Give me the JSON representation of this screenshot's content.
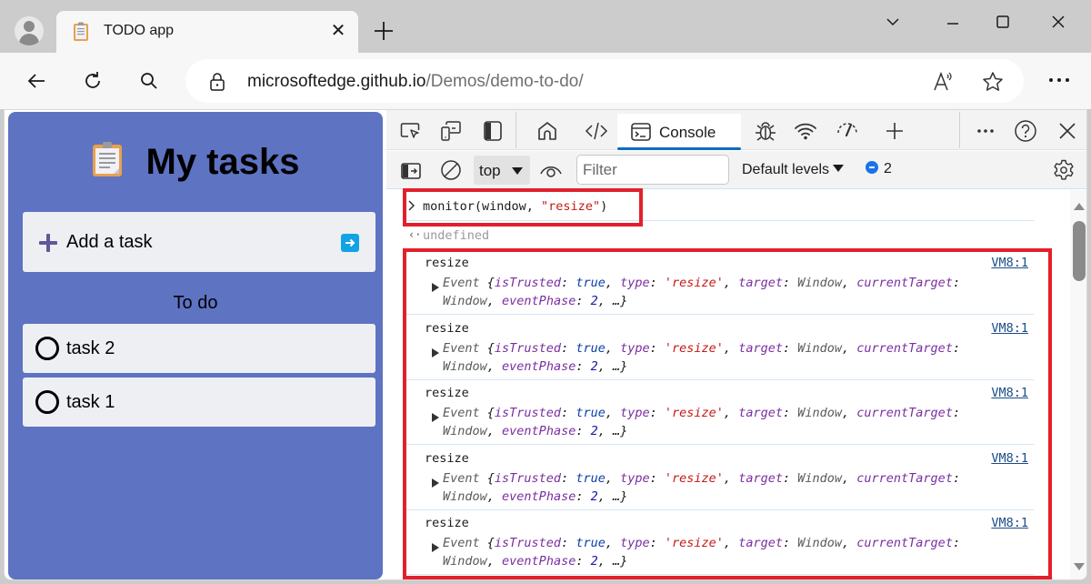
{
  "browser": {
    "tab": {
      "title": "TODO app",
      "favicon": "clipboard-icon"
    },
    "address_bar": {
      "host": "microsoftedge.github.io",
      "path": "/Demos/demo-to-do/"
    },
    "icons": [
      "profile-icon",
      "close-icon",
      "plus-icon",
      "chevron-down-icon",
      "minimize-icon",
      "maximize-icon",
      "window-close-icon",
      "back-icon",
      "refresh-icon",
      "search-icon",
      "lock-icon",
      "read-aloud-icon",
      "favorite-star-icon",
      "more-icon"
    ]
  },
  "todo_app": {
    "title": "My tasks",
    "add_task_label": "Add a task",
    "section_title": "To do",
    "tasks": [
      {
        "label": "task 2",
        "done": false
      },
      {
        "label": "task 1",
        "done": false
      }
    ],
    "colors": {
      "background": "#5f73c3",
      "card": "#eeeff3",
      "submit": "#12a3e6"
    }
  },
  "devtools": {
    "tabs": [
      {
        "name": "welcome",
        "icon": "home-icon"
      },
      {
        "name": "elements",
        "icon": "code-icon"
      },
      {
        "name": "console",
        "label": "Console",
        "icon": "console-icon",
        "active": true
      },
      {
        "name": "sources",
        "icon": "bug-icon"
      },
      {
        "name": "network",
        "icon": "wifi-icon"
      },
      {
        "name": "performance",
        "icon": "gauge-icon"
      },
      {
        "name": "more-tools",
        "icon": "plus-icon"
      }
    ],
    "console_tab_label": "Console",
    "toolbar": {
      "context": "top",
      "filter_placeholder": "Filter",
      "levels": "Default levels",
      "message_count": "2"
    },
    "console": {
      "command": {
        "prefix": "monitor(window, ",
        "string": "\"resize\"",
        "suffix": ")"
      },
      "result": "undefined",
      "logs": [
        {
          "title": "resize",
          "source": "VM8:1"
        },
        {
          "title": "resize",
          "source": "VM8:1"
        },
        {
          "title": "resize",
          "source": "VM8:1"
        },
        {
          "title": "resize",
          "source": "VM8:1"
        },
        {
          "title": "resize",
          "source": "VM8:1"
        }
      ],
      "event_object": {
        "class": "Event",
        "isTrusted": "true",
        "type": "'resize'",
        "target": "Window",
        "currentTarget": "Window",
        "eventPhase": "2",
        "ellipsis": "…"
      }
    },
    "accent_color": "#0f6cbd",
    "highlight_color": "#e3202a"
  }
}
